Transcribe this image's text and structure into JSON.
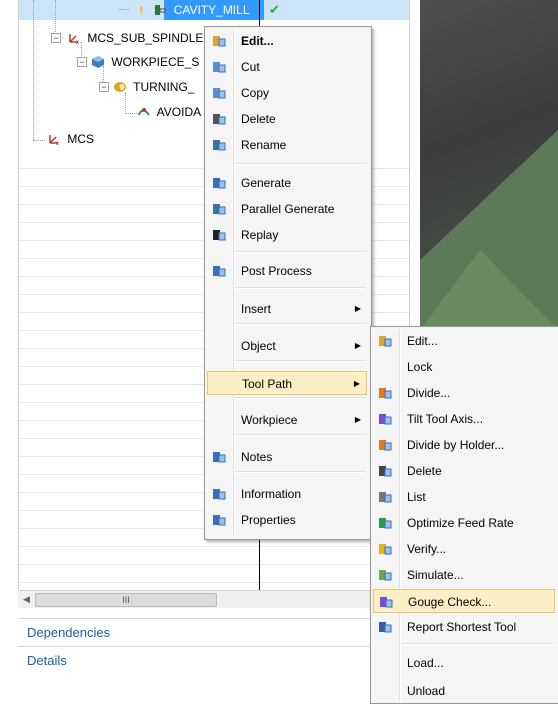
{
  "tree": {
    "rows": [
      {
        "label": "CAVITY_MILL",
        "selected": true
      },
      {
        "label": "MCS_SUB_SPINDLE"
      },
      {
        "label": "WORKPIECE_S"
      },
      {
        "label": "TURNING_"
      },
      {
        "label": "AVOIDA"
      },
      {
        "label": "MCS"
      }
    ],
    "check_glyph": "✔",
    "colors": {
      "selected": "#3399ff",
      "check": "#2fa82f"
    }
  },
  "scrollbar": {
    "left": "◀",
    "right": "▶",
    "grip": "III"
  },
  "sections": {
    "dependencies": "Dependencies",
    "details": "Details"
  },
  "context_menu": {
    "items": [
      {
        "label": "Edit...",
        "icon": "edit-icon",
        "bold": true
      },
      {
        "label": "Cut",
        "icon": "cut-icon"
      },
      {
        "label": "Copy",
        "icon": "copy-icon"
      },
      {
        "label": "Delete",
        "icon": "delete-icon"
      },
      {
        "label": "Rename",
        "icon": "rename-icon"
      },
      {
        "label": "Generate",
        "icon": "generate-icon"
      },
      {
        "label": "Parallel Generate",
        "icon": "parallel-generate-icon"
      },
      {
        "label": "Replay",
        "icon": "replay-icon"
      },
      {
        "label": "Post Process",
        "icon": "post-process-icon"
      },
      {
        "label": "Insert",
        "submenu": true
      },
      {
        "label": "Object",
        "submenu": true
      },
      {
        "label": "Tool Path",
        "submenu": true,
        "highlighted": true
      },
      {
        "label": "Workpiece",
        "submenu": true
      },
      {
        "label": "Notes",
        "icon": "notes-icon"
      },
      {
        "label": "Information",
        "icon": "information-icon"
      },
      {
        "label": "Properties",
        "icon": "properties-icon"
      }
    ]
  },
  "tool_path_submenu": {
    "items": [
      {
        "label": "Edit...",
        "icon": "edit-path-icon"
      },
      {
        "label": "Lock"
      },
      {
        "label": "Divide...",
        "icon": "divide-icon"
      },
      {
        "label": "Tilt Tool Axis...",
        "icon": "tilt-axis-icon"
      },
      {
        "label": "Divide by Holder...",
        "icon": "divide-holder-icon"
      },
      {
        "label": "Delete",
        "icon": "delete-path-icon"
      },
      {
        "label": "List",
        "icon": "list-icon"
      },
      {
        "label": "Optimize Feed Rate",
        "icon": "optimize-feed-icon"
      },
      {
        "label": "Verify...",
        "icon": "verify-icon"
      },
      {
        "label": "Simulate...",
        "icon": "simulate-icon"
      },
      {
        "label": "Gouge Check...",
        "icon": "gouge-check-icon",
        "highlighted": true
      },
      {
        "label": "Report Shortest Tool",
        "icon": "report-tool-icon"
      },
      {
        "label": "Load..."
      },
      {
        "label": "Unload"
      }
    ]
  }
}
